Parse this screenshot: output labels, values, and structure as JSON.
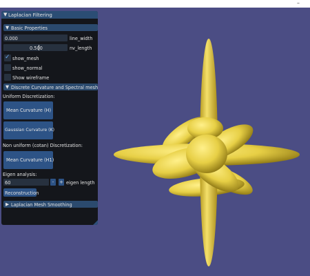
{
  "window": {
    "title": "Laplacian Filtering",
    "collapse_icon": "triangle-down-icon"
  },
  "basic_properties": {
    "header": "Basic Properties",
    "line_width": {
      "value": "0.000",
      "label": "line_width"
    },
    "nv_length": {
      "value": "0.500",
      "label": "nv_length"
    },
    "show_mesh": {
      "label": "show_mesh",
      "checked": true
    },
    "show_normal": {
      "label": "show_normal",
      "checked": false
    },
    "show_wireframe": {
      "label": "Show wireframe",
      "checked": false
    }
  },
  "curvature": {
    "header": "Discrete Curvature and Spectral meshes",
    "uniform_label": "Uniform Discretization:",
    "mean_uniform_button": "Mean Curvature (H)",
    "gaussian_button": "Gaussian Curvature (K)",
    "cotan_label": "Non uniform (cotan) Discretization:",
    "mean_cotan_button": "Mean Curvature (H1)",
    "eigen_label": "Eigen analysis:",
    "eigen_length": {
      "value": "60",
      "label": "eigen length",
      "minus": "-",
      "plus": "+"
    },
    "reconstruction_button": "Reconstruction"
  },
  "smoothing": {
    "header": "Laplacian Mesh Smoothing"
  },
  "topbar": {
    "glyph": "–"
  },
  "colors": {
    "background": "#4b4d84",
    "mesh": "#e7cf45",
    "panel": "#14161b",
    "header": "#2b4a6e",
    "button": "#2d5386"
  }
}
